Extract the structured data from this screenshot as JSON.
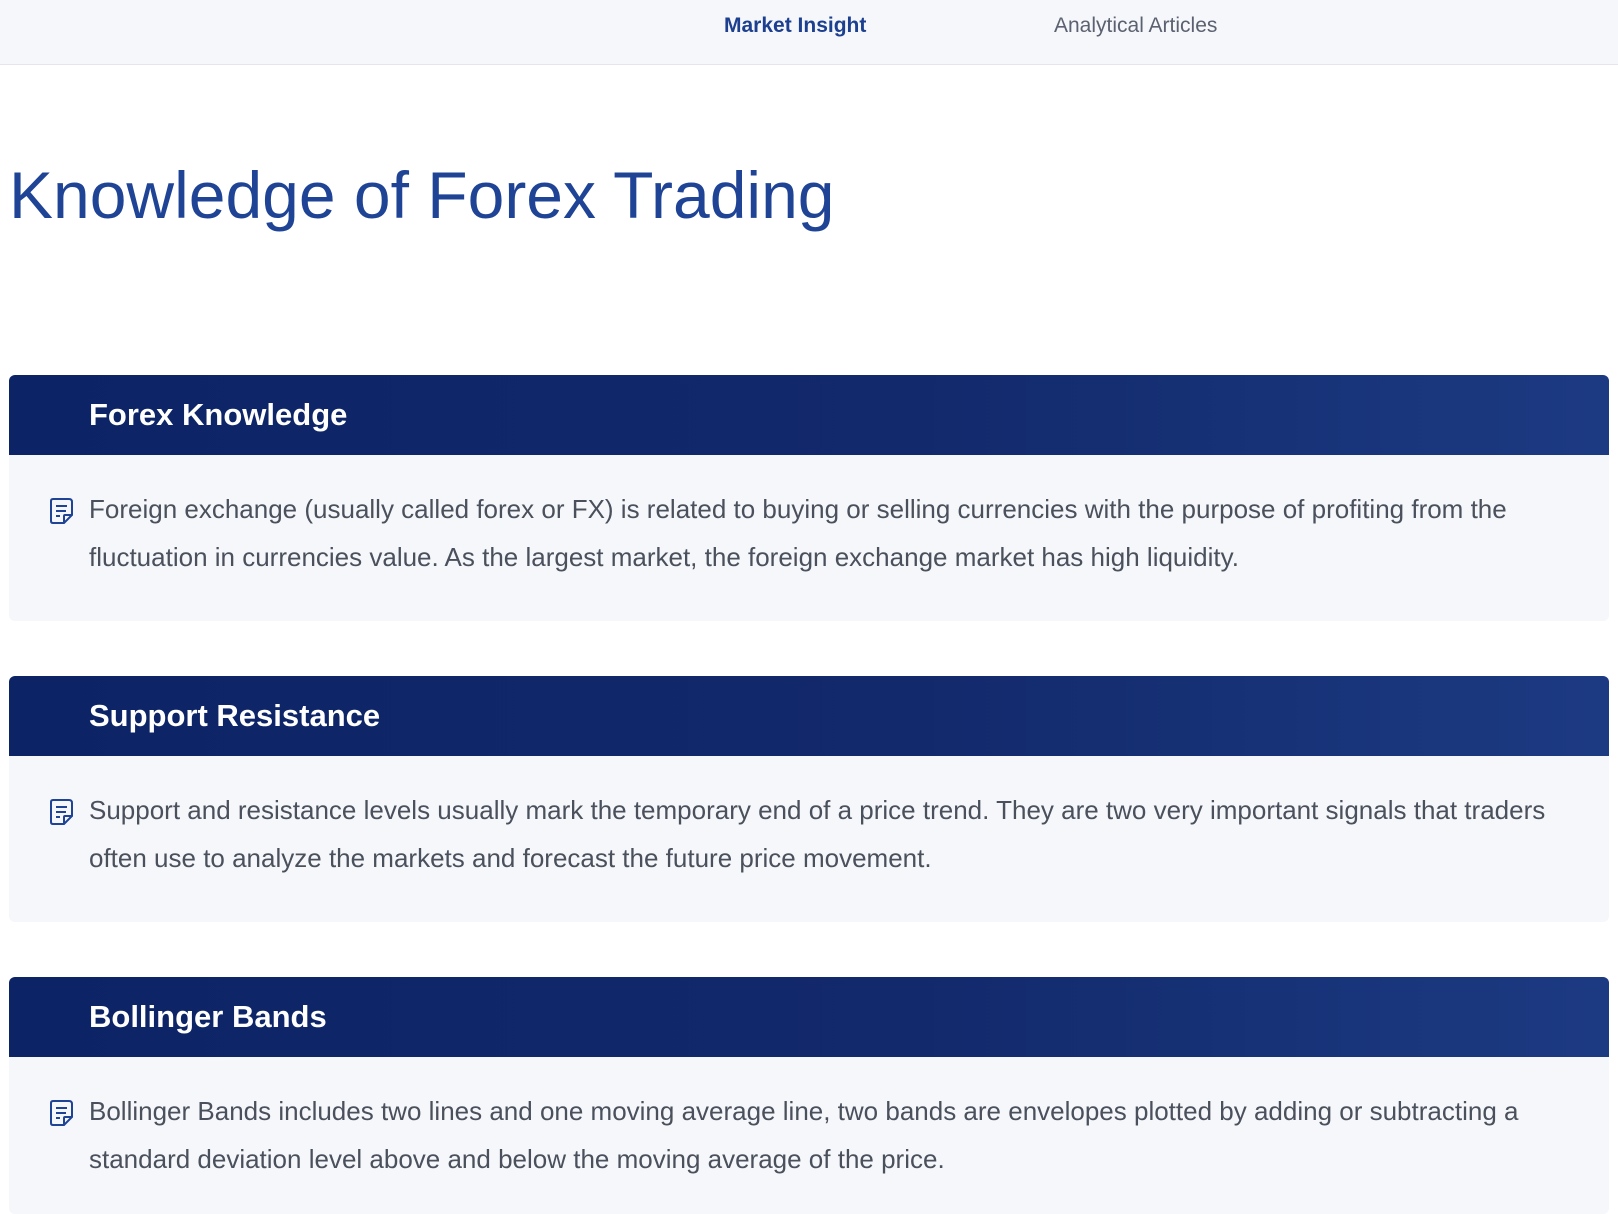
{
  "nav": {
    "tabs": [
      {
        "label": "Market Insight",
        "active": true
      },
      {
        "label": "Analytical Articles",
        "active": false
      }
    ]
  },
  "page": {
    "title": "Knowledge of Forex Trading"
  },
  "cards": [
    {
      "title": "Forex Knowledge",
      "text": "Foreign exchange (usually called forex or FX) is related to buying or selling currencies with the purpose of profiting from the fluctuation in currencies value. As the largest market, the foreign exchange market has high liquidity.",
      "icon": "document-icon"
    },
    {
      "title": "Support Resistance",
      "text": "Support and resistance levels usually mark the temporary end of a price trend. They are two very important signals that traders often use to analyze the markets and forecast the future price movement.",
      "icon": "document-icon"
    },
    {
      "title": "Bollinger Bands",
      "text": "Bollinger Bands includes two lines and one moving average line, two bands are envelopes plotted by adding or subtracting a standard deviation level above and below the moving average of the price.",
      "icon": "document-icon"
    }
  ],
  "colors": {
    "accent": "#1f4496",
    "header_bg": "#0c2466",
    "body_bg": "#f5f7fa",
    "text": "#4a505c"
  }
}
